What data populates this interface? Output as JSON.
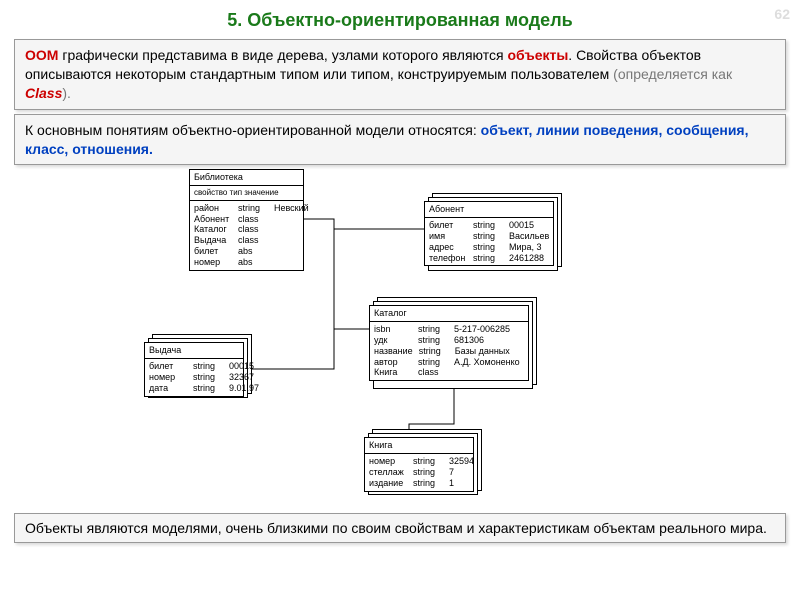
{
  "page_number": "62",
  "title": "5. Объектно-ориентированная модель",
  "box1": {
    "oom": "ООМ",
    "text1": " графически представима в виде дерева, узлами которого являются ",
    "objects": "объекты",
    "text2": ". Свойства объектов описываются некоторым стандартным типом или типом, конструируемым пользователем ",
    "gray1": "(определяется как ",
    "class": "Class",
    "gray2": ")."
  },
  "box2": {
    "text1": "К основным понятиям объектно-ориентированной модели относятся: ",
    "terms": "объект, линии поведения, сообщения, класс, отношения."
  },
  "diagram": {
    "library": {
      "title": "Библиотека",
      "header": "свойство  тип  значение",
      "rows": [
        {
          "c1": "район",
          "c2": "string",
          "c3": "Невский"
        },
        {
          "c1": "Абонент",
          "c2": "class",
          "c3": ""
        },
        {
          "c1": "Каталог",
          "c2": "class",
          "c3": ""
        },
        {
          "c1": "Выдача",
          "c2": "class",
          "c3": ""
        },
        {
          "c1": "билет",
          "c2": "abs",
          "c3": ""
        },
        {
          "c1": "номер",
          "c2": "abs",
          "c3": ""
        }
      ]
    },
    "abonent": {
      "title": "Абонент",
      "rows": [
        {
          "c1": "билет",
          "c2": "string",
          "c3": "00015"
        },
        {
          "c1": "имя",
          "c2": "string",
          "c3": "Васильев"
        },
        {
          "c1": "адрес",
          "c2": "string",
          "c3": "Мира, 3"
        },
        {
          "c1": "телефон",
          "c2": "string",
          "c3": "2461288"
        }
      ]
    },
    "vydacha": {
      "title": "Выдача",
      "rows": [
        {
          "c1": "билет",
          "c2": "string",
          "c3": "00015"
        },
        {
          "c1": "номер",
          "c2": "string",
          "c3": "32367"
        },
        {
          "c1": "дата",
          "c2": "string",
          "c3": "9.01.97"
        }
      ]
    },
    "catalog": {
      "title": "Каталог",
      "rows": [
        {
          "c1": "isbn",
          "c2": "string",
          "c3": "5-217-006285"
        },
        {
          "c1": "удк",
          "c2": "string",
          "c3": "681306"
        },
        {
          "c1": "название",
          "c2": "string",
          "c3": "Базы данных"
        },
        {
          "c1": "автор",
          "c2": "string",
          "c3": "А.Д. Хомоненко"
        },
        {
          "c1": "Книга",
          "c2": "class",
          "c3": ""
        }
      ]
    },
    "book": {
      "title": "Книга",
      "rows": [
        {
          "c1": "номер",
          "c2": "string",
          "c3": "32594"
        },
        {
          "c1": "стеллаж",
          "c2": "string",
          "c3": "7"
        },
        {
          "c1": "издание",
          "c2": "string",
          "c3": "1"
        }
      ]
    }
  },
  "footer": "Объекты являются моделями, очень близкими по своим свойствам и характеристикам объектам реального мира."
}
